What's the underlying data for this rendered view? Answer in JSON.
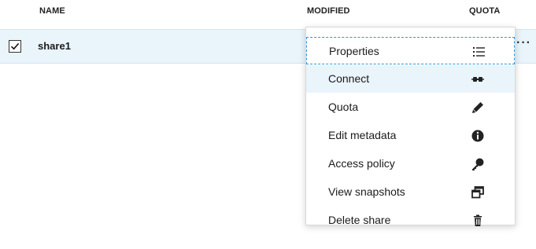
{
  "header": {
    "name": "NAME",
    "modified": "MODIFIED",
    "quota": "QUOTA"
  },
  "row": {
    "name": "share1",
    "checked": true,
    "more": "···"
  },
  "menu": {
    "items": [
      {
        "label": "Properties",
        "icon": "list-icon"
      },
      {
        "label": "Connect",
        "icon": "plug-icon"
      },
      {
        "label": "Quota",
        "icon": "pencil-icon"
      },
      {
        "label": "Edit metadata",
        "icon": "info-icon"
      },
      {
        "label": "Access policy",
        "icon": "key-icon"
      },
      {
        "label": "View snapshots",
        "icon": "snapshot-icon"
      },
      {
        "label": "Delete share",
        "icon": "trash-icon"
      }
    ]
  },
  "colors": {
    "selected_row": "#e9f4fb",
    "focus_outline": "#2f95d6"
  }
}
